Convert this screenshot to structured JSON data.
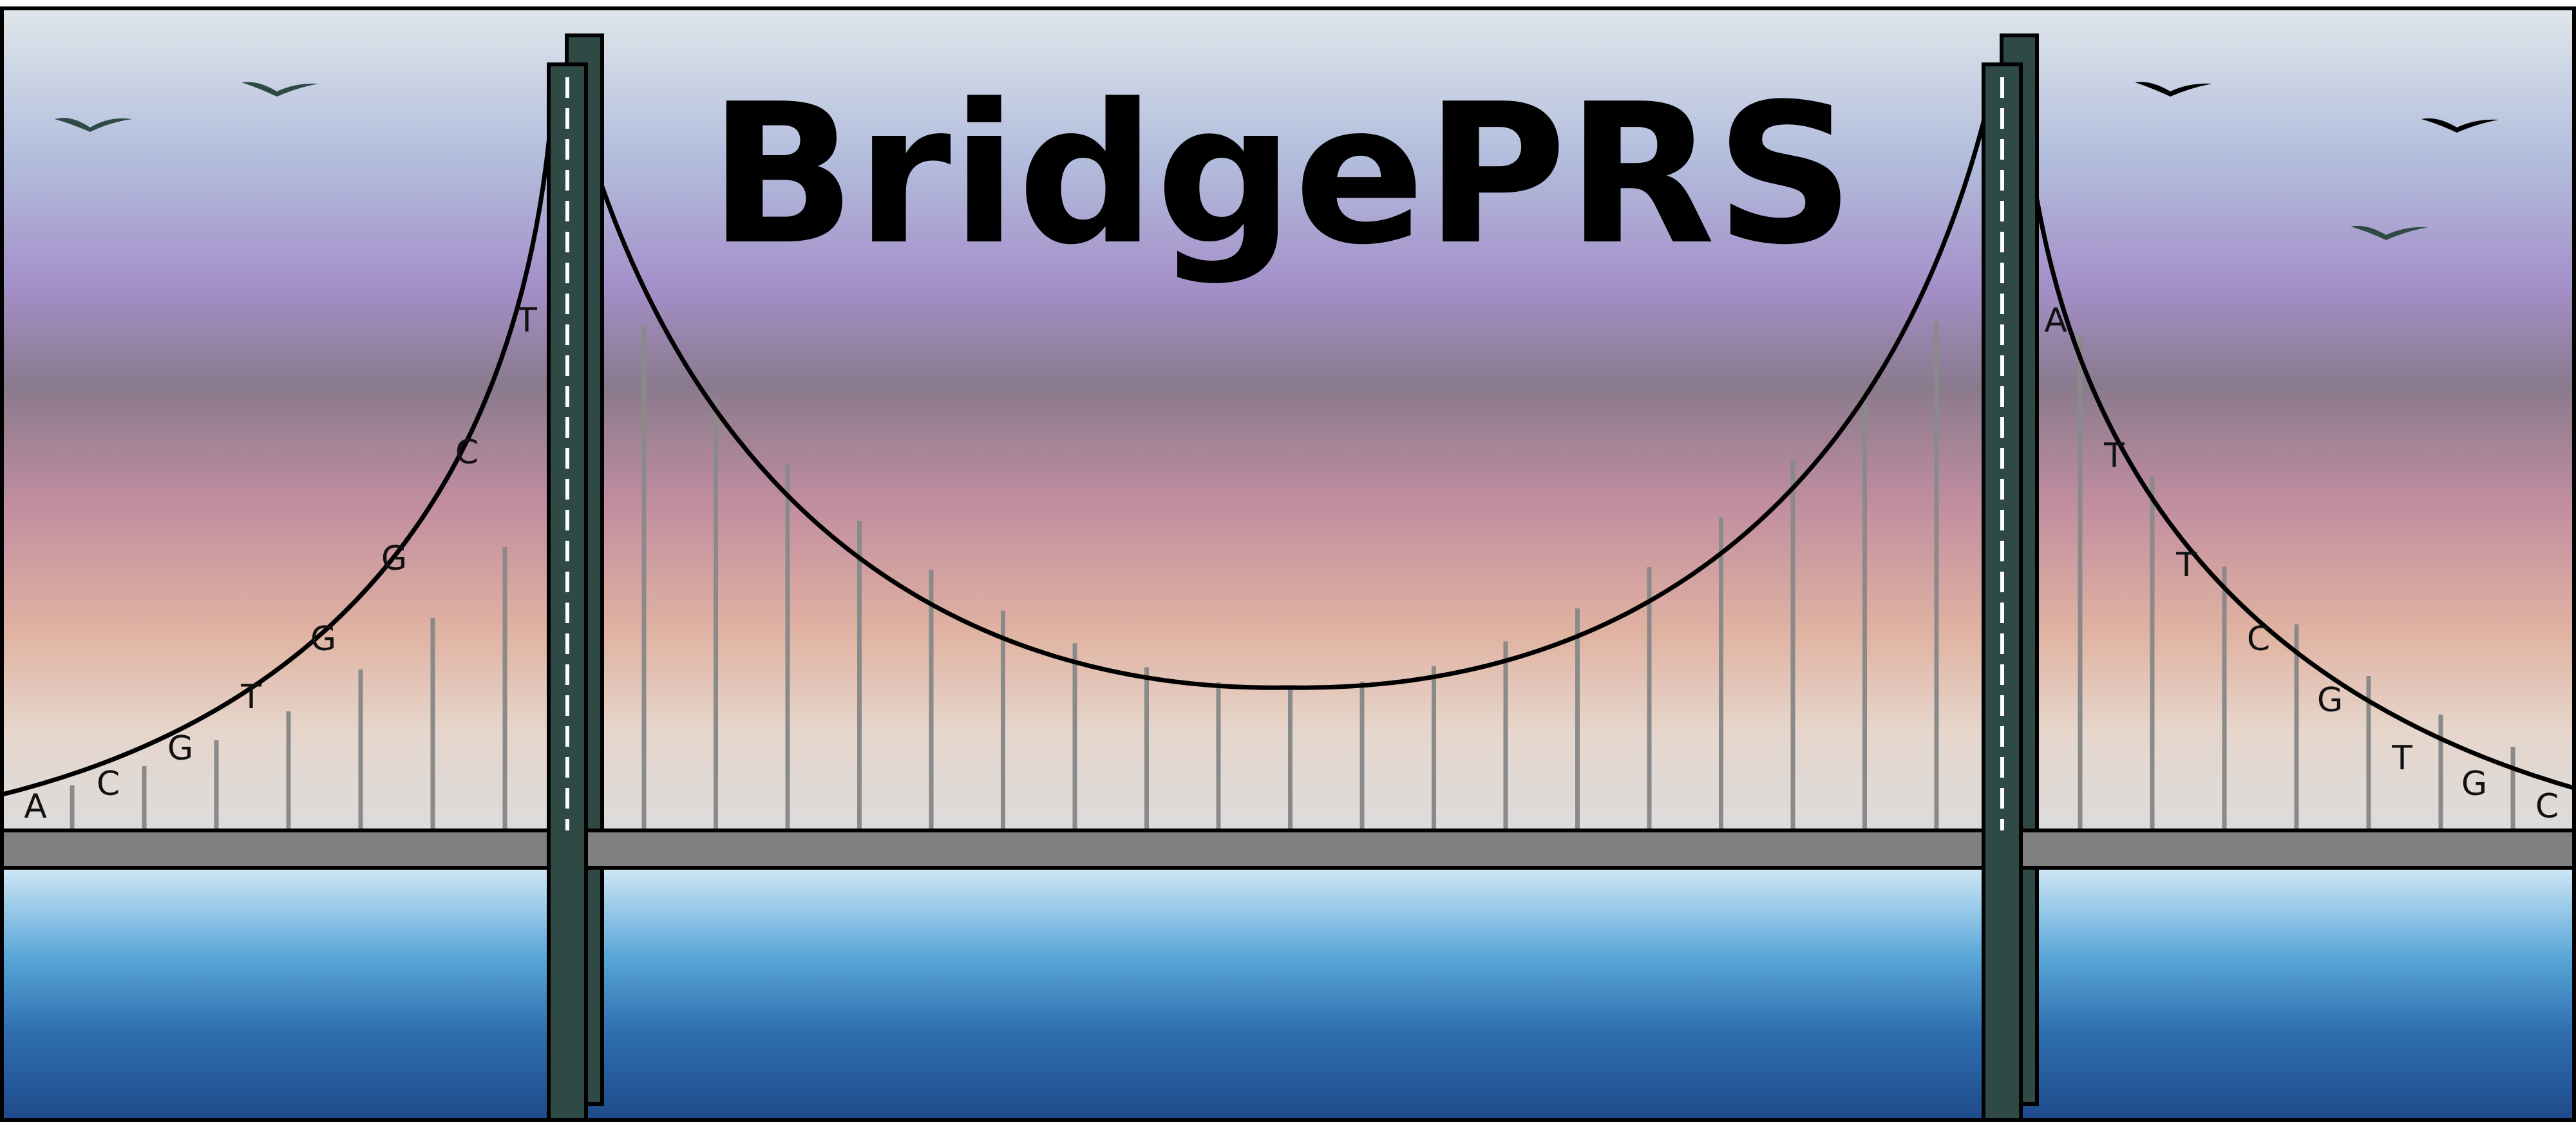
{
  "title": "BridgePRS",
  "left_letters": [
    "A",
    "C",
    "G",
    "T",
    "G",
    "G",
    "C",
    "T"
  ],
  "right_letters": [
    "A",
    "T",
    "T",
    "C",
    "G",
    "T",
    "G",
    "C"
  ],
  "colors": {
    "sky_top": "#dfe6ea",
    "sky_purple": "#a48fc8",
    "sky_mauve": "#8a7a8d",
    "sky_pink": "#c08da0",
    "sky_peach": "#e7c7b4",
    "sky_bottom": "#dcdcdc",
    "water_top": "#cfe7f5",
    "water_mid": "#3d8cc8",
    "water_bottom": "#1e4a8a",
    "tower": "#2f4a45",
    "deck": "#808080",
    "hanger": "#8a8a8a",
    "cable": "#000000",
    "bird": "#2f4a45"
  },
  "icons": {
    "bird": "bird-icon",
    "tower": "tower-icon"
  }
}
